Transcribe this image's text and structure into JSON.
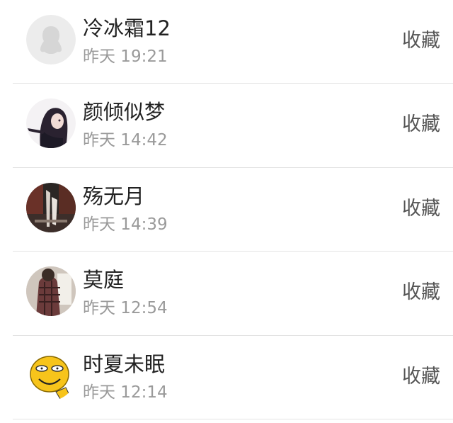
{
  "rows": [
    {
      "name": "冷冰霜12",
      "time": "昨天 19:21",
      "action": "收藏",
      "avatar_icon": "default-penguin-avatar"
    },
    {
      "name": "颜倾似梦",
      "time": "昨天 14:42",
      "action": "收藏",
      "avatar_icon": "anime-girl-avatar"
    },
    {
      "name": "殇无月",
      "time": "昨天 14:39",
      "action": "收藏",
      "avatar_icon": "dark-scene-avatar"
    },
    {
      "name": "莫庭",
      "time": "昨天 12:54",
      "action": "收藏",
      "avatar_icon": "person-plaid-shirt-avatar"
    },
    {
      "name": "时夏未眠",
      "time": "昨天 12:14",
      "action": "收藏",
      "avatar_icon": "smiley-face-avatar"
    }
  ],
  "colors": {
    "name": "#222222",
    "time": "#9a9a9a",
    "action": "#555555",
    "divider": "#e3e3e3"
  }
}
